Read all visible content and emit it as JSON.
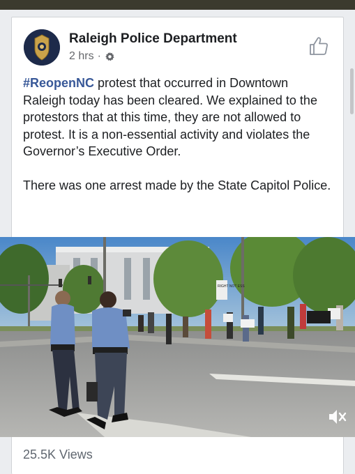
{
  "post": {
    "page_name": "Raleigh Police Department",
    "timestamp": "2 hrs",
    "separator": "·",
    "audience_icon": "gear-icon",
    "hashtag": "#ReopenNC",
    "text_part1": " protest that occurred in Downtown Raleigh today has been cleared. We explained to the protestors that at this time, they are not allowed to protest. It is a non-essential activity and violates the Governor’s Executive Order.",
    "text_para2": "There was one arrest made by the State Capitol Police.",
    "like_icon": "thumbs-up-icon"
  },
  "video": {
    "sign_text": "RIGHT NOT ESS",
    "mute_icon": "speaker-muted-icon"
  },
  "stats": {
    "views": "25.5K Views"
  },
  "colors": {
    "hashtag": "#385898",
    "text": "#1c1e21",
    "secondary": "#65676b",
    "topbar": "#3b3a2e"
  }
}
